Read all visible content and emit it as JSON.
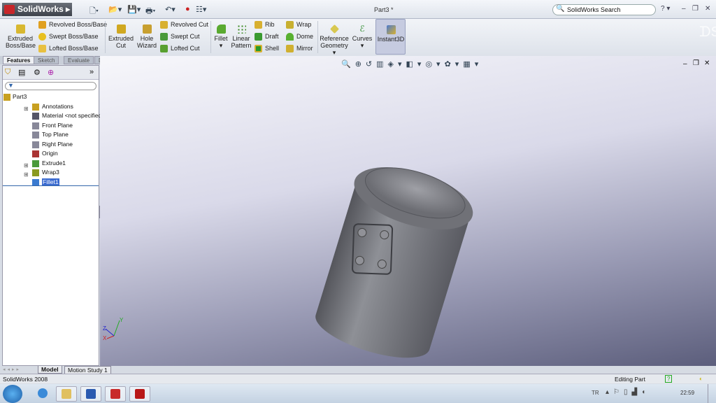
{
  "app": {
    "name": "SolidWorks",
    "document_title": "Part3 *",
    "search_placeholder": "SolidWorks Search"
  },
  "ribbon": {
    "extruded_boss": "Extruded Boss/Base",
    "revolved_boss": "Revolved Boss/Base",
    "swept_boss": "Swept Boss/Base",
    "lofted_boss": "Lofted Boss/Base",
    "extruded_cut": "Extruded Cut",
    "hole_wizard": "Hole Wizard",
    "revolved_cut": "Revolved Cut",
    "swept_cut": "Swept Cut",
    "lofted_cut": "Lofted Cut",
    "fillet": "Fillet",
    "linear_pattern": "Linear Pattern",
    "rib": "Rib",
    "draft": "Draft",
    "shell": "Shell",
    "wrap": "Wrap",
    "dome": "Dome",
    "mirror": "Mirror",
    "reference_geometry": "Reference Geometry",
    "curves": "Curves",
    "instant3d": "Instant3D"
  },
  "tabs": [
    "Features",
    "Sketch",
    "Evaluate",
    "DimXpert"
  ],
  "tree": {
    "root": "Part3",
    "items": [
      {
        "label": "Annotations",
        "expandable": true,
        "color": "#c8a020"
      },
      {
        "label": "Material <not specified>",
        "expandable": false,
        "color": "#556"
      },
      {
        "label": "Front Plane",
        "expandable": false,
        "color": "#889"
      },
      {
        "label": "Top Plane",
        "expandable": false,
        "color": "#889"
      },
      {
        "label": "Right Plane",
        "expandable": false,
        "color": "#889"
      },
      {
        "label": "Origin",
        "expandable": false,
        "color": "#a33"
      },
      {
        "label": "Extrude1",
        "expandable": true,
        "color": "#4a9a3a"
      },
      {
        "label": "Wrap3",
        "expandable": true,
        "color": "#8a9a20"
      },
      {
        "label": "Fillet1",
        "expandable": false,
        "color": "#3a7ad0",
        "selected": true
      }
    ]
  },
  "bottom_tabs": [
    "Model",
    "Motion Study 1"
  ],
  "status": {
    "left": "SolidWorks 2008",
    "right": "Editing Part"
  },
  "taskbar": {
    "lang": "TR",
    "time": "22:59"
  }
}
